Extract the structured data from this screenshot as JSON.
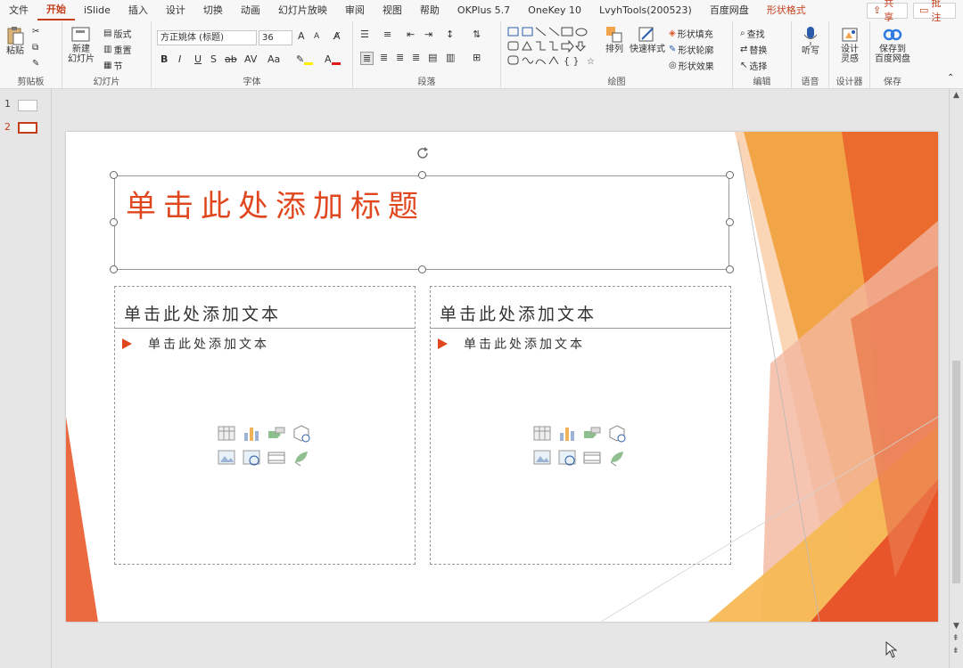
{
  "tabs": [
    "文件",
    "开始",
    "iSlide",
    "插入",
    "设计",
    "切换",
    "动画",
    "幻灯片放映",
    "审阅",
    "视图",
    "帮助",
    "OKPlus 5.7",
    "OneKey 10",
    "LvyhTools(200523)",
    "百度网盘",
    "形状格式"
  ],
  "active_tab": "开始",
  "share_label": "共享",
  "comment_label": "批注",
  "ribbon": {
    "clipboard": {
      "paste": "粘贴",
      "label": "剪贴板"
    },
    "slides": {
      "new_slide_line1": "新建",
      "new_slide_line2": "幻灯片",
      "layout": "版式",
      "reset": "重置",
      "section": "节",
      "label": "幻灯片"
    },
    "font": {
      "font_name": "方正姚体 (标题)",
      "font_size": "36",
      "bold": "B",
      "italic": "I",
      "underline": "U",
      "shadow": "S",
      "strike": "ab",
      "spacing": "AV",
      "case": "Aa",
      "grow": "A",
      "shrink": "A",
      "label": "字体"
    },
    "paragraph": {
      "label": "段落"
    },
    "drawing": {
      "arrange": "排列",
      "quick_styles": "快速样式",
      "shape_fill": "形状填充",
      "shape_outline": "形状轮廓",
      "shape_effects": "形状效果",
      "label": "绘图"
    },
    "editing": {
      "find": "查找",
      "replace": "替换",
      "select": "选择",
      "label": "编辑"
    },
    "voice": {
      "dictate": "听写",
      "label": "语音"
    },
    "designer": {
      "line1": "设计",
      "line2": "灵感",
      "label": "设计器"
    },
    "save": {
      "line1": "保存到",
      "line2": "百度网盘",
      "label": "保存"
    }
  },
  "thumbnails": [
    "1",
    "2"
  ],
  "selected_thumbnail": "2",
  "slide": {
    "title": "单击此处添加标题",
    "left": {
      "heading": "单击此处添加文本",
      "bullet": "单击此处添加文本"
    },
    "right": {
      "heading": "单击此处添加文本",
      "bullet": "单击此处添加文本"
    }
  },
  "colors": {
    "accent": "#c43e1c",
    "title": "#e0471f",
    "orange": "#f0a032"
  }
}
